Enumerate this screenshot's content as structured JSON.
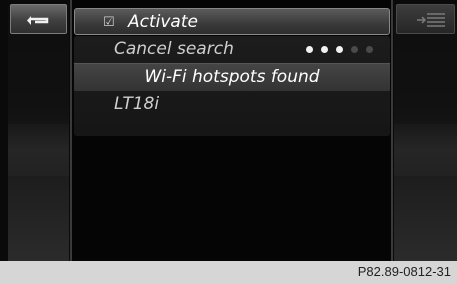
{
  "menu": {
    "activate_label": "Activate",
    "cancel_label": "Cancel search",
    "found_label": "Wi-Fi hotspots found",
    "networks": [
      {
        "label": "LT18i"
      }
    ]
  },
  "search_progress": {
    "active_dots": 3,
    "total_dots": 5
  },
  "icons": {
    "back": "back-arrow-icon",
    "menu": "list-menu-icon",
    "activate": "checkbox-checked-icon"
  },
  "caption": "P82.89-0812-31"
}
